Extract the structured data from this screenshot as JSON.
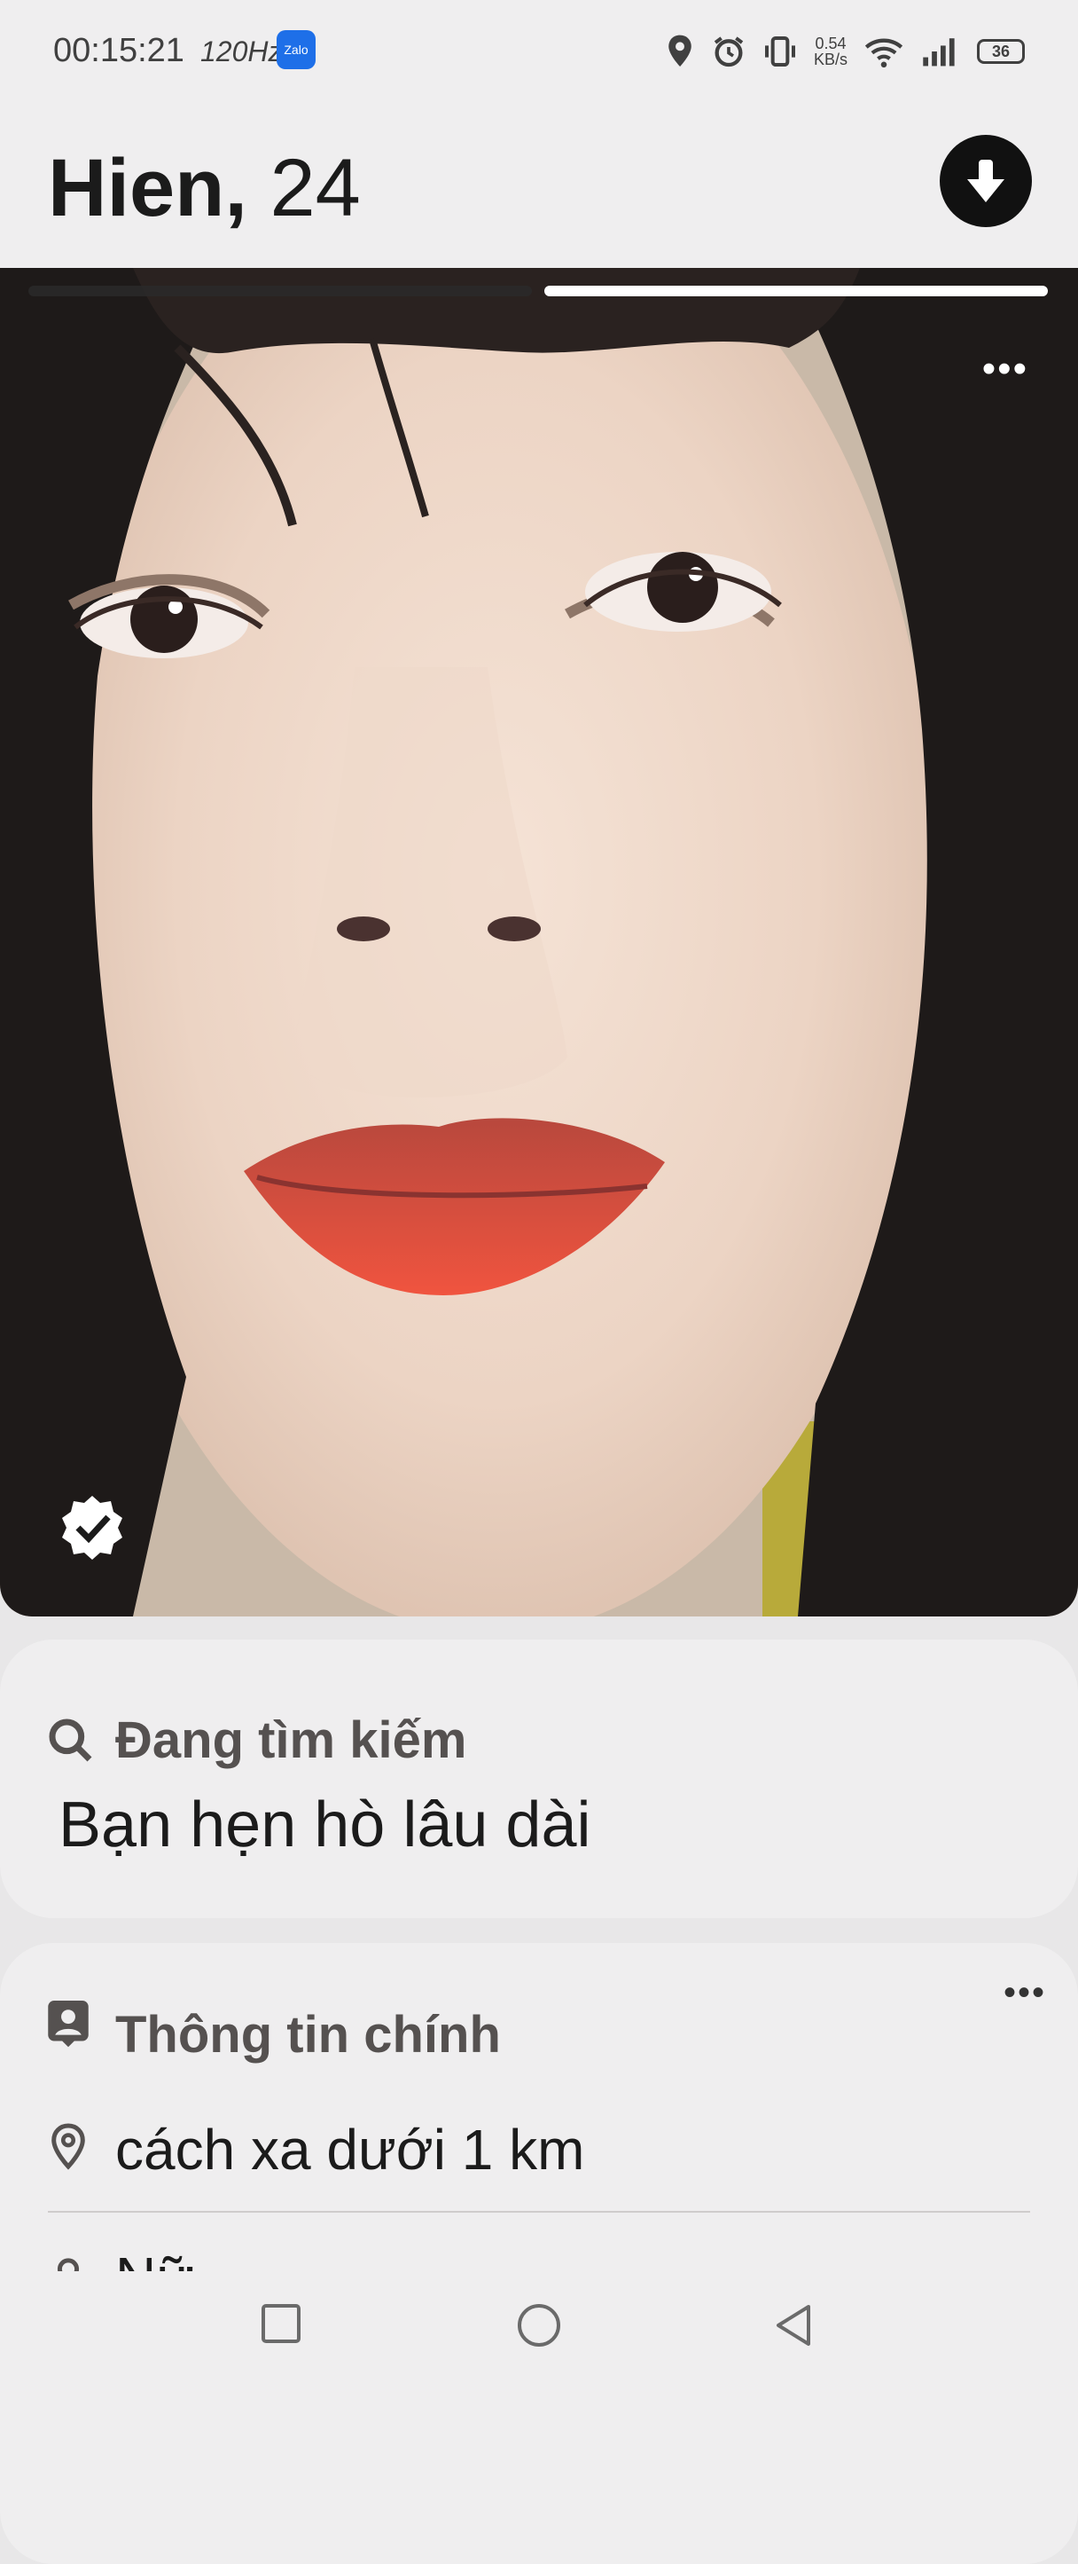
{
  "status_bar": {
    "time": "00:15:21",
    "refresh_rate": "120Hz",
    "zalo_label": "Zalo",
    "net_speed_value": "0.54",
    "net_speed_unit": "KB/s",
    "battery": "36"
  },
  "profile": {
    "name": "Hien,",
    "age": "24"
  },
  "photos": {
    "count": 2,
    "current_index": 1
  },
  "looking_for": {
    "heading": "Đang tìm kiếm",
    "value": "Bạn hẹn hò lâu dài"
  },
  "basics": {
    "heading": "Thông tin chính",
    "distance": "cách xa dưới 1 km",
    "gender": "Nữ"
  },
  "colors": {
    "background": "#e8e7e8",
    "card": "#efeeef",
    "text": "#1b1b1b",
    "muted": "#555150"
  },
  "icons": [
    "location-icon",
    "alarm-icon",
    "vibrate-icon",
    "wifi-icon",
    "signal-icon",
    "battery-icon",
    "arrow-down-icon",
    "more-icon",
    "verified-badge-icon",
    "search-icon",
    "id-card-icon",
    "map-pin-icon",
    "person-icon",
    "square-nav-icon",
    "circle-nav-icon",
    "back-triangle-icon"
  ]
}
